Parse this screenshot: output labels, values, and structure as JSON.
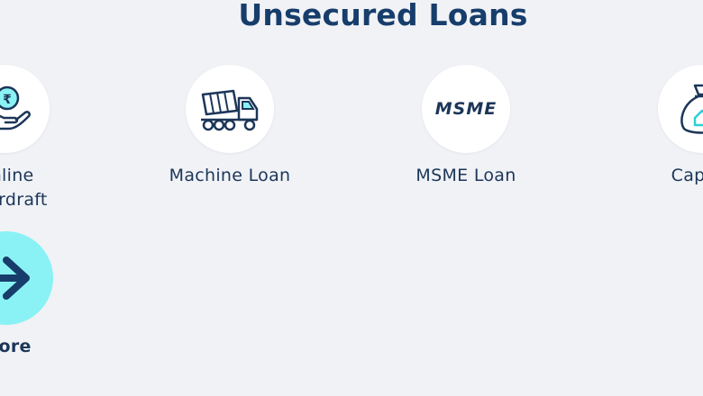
{
  "section": {
    "title": "Unsecured Loans"
  },
  "tiles": [
    {
      "label_lines": [
        "Online",
        "Overdraft"
      ],
      "icon": "hand-with-coin-icon"
    },
    {
      "label": "Machine Loan",
      "icon": "cement-mixer-truck-icon"
    },
    {
      "label": "MSME Loan",
      "icon": "msme-logo-icon",
      "logo_text": "MSME"
    },
    {
      "label": "Capital",
      "icon": "money-bag-icon"
    }
  ],
  "more": {
    "label": "More",
    "icon": "arrow-right-icon"
  },
  "colors": {
    "background": "#f0f2f6",
    "heading": "#173d6b",
    "icon_stroke": "#1c3658",
    "accent_cyan": "#8af2f4",
    "circle_bg": "#ffffff"
  }
}
